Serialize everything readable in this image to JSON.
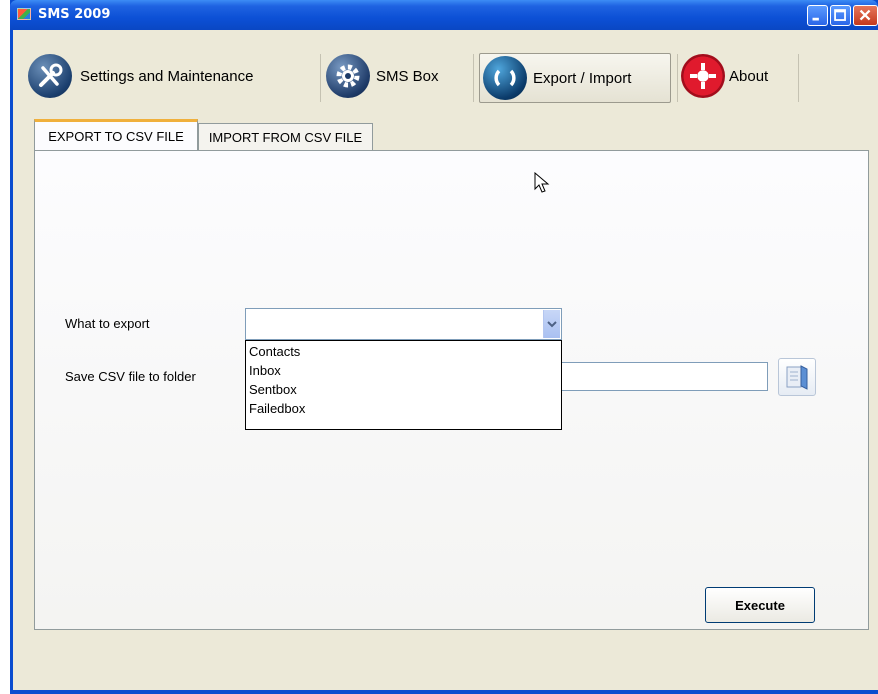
{
  "window": {
    "title": "SMS 2009"
  },
  "toolbar": {
    "items": [
      {
        "label": "Settings and Maintenance",
        "icon": "tools-icon"
      },
      {
        "label": "SMS Box",
        "icon": "gear-icon"
      },
      {
        "label": "Export / Import",
        "icon": "refresh-icon",
        "active": true
      },
      {
        "label": "About",
        "icon": "lifebuoy-icon"
      }
    ]
  },
  "tabs": [
    {
      "label": "EXPORT TO CSV FILE",
      "active": true
    },
    {
      "label": "IMPORT FROM CSV FILE",
      "active": false
    }
  ],
  "form": {
    "what_to_export_label": "What to export",
    "what_to_export_value": "",
    "save_folder_label": "Save CSV file to folder",
    "save_folder_value": "",
    "dropdown_options": [
      "Contacts",
      "Inbox",
      "Sentbox",
      "Failedbox"
    ],
    "execute_label": "Execute"
  },
  "colors": {
    "titlebar": "#0a4ccf",
    "client_bg": "#ece9d8",
    "tab_accent": "#f0b03c"
  }
}
